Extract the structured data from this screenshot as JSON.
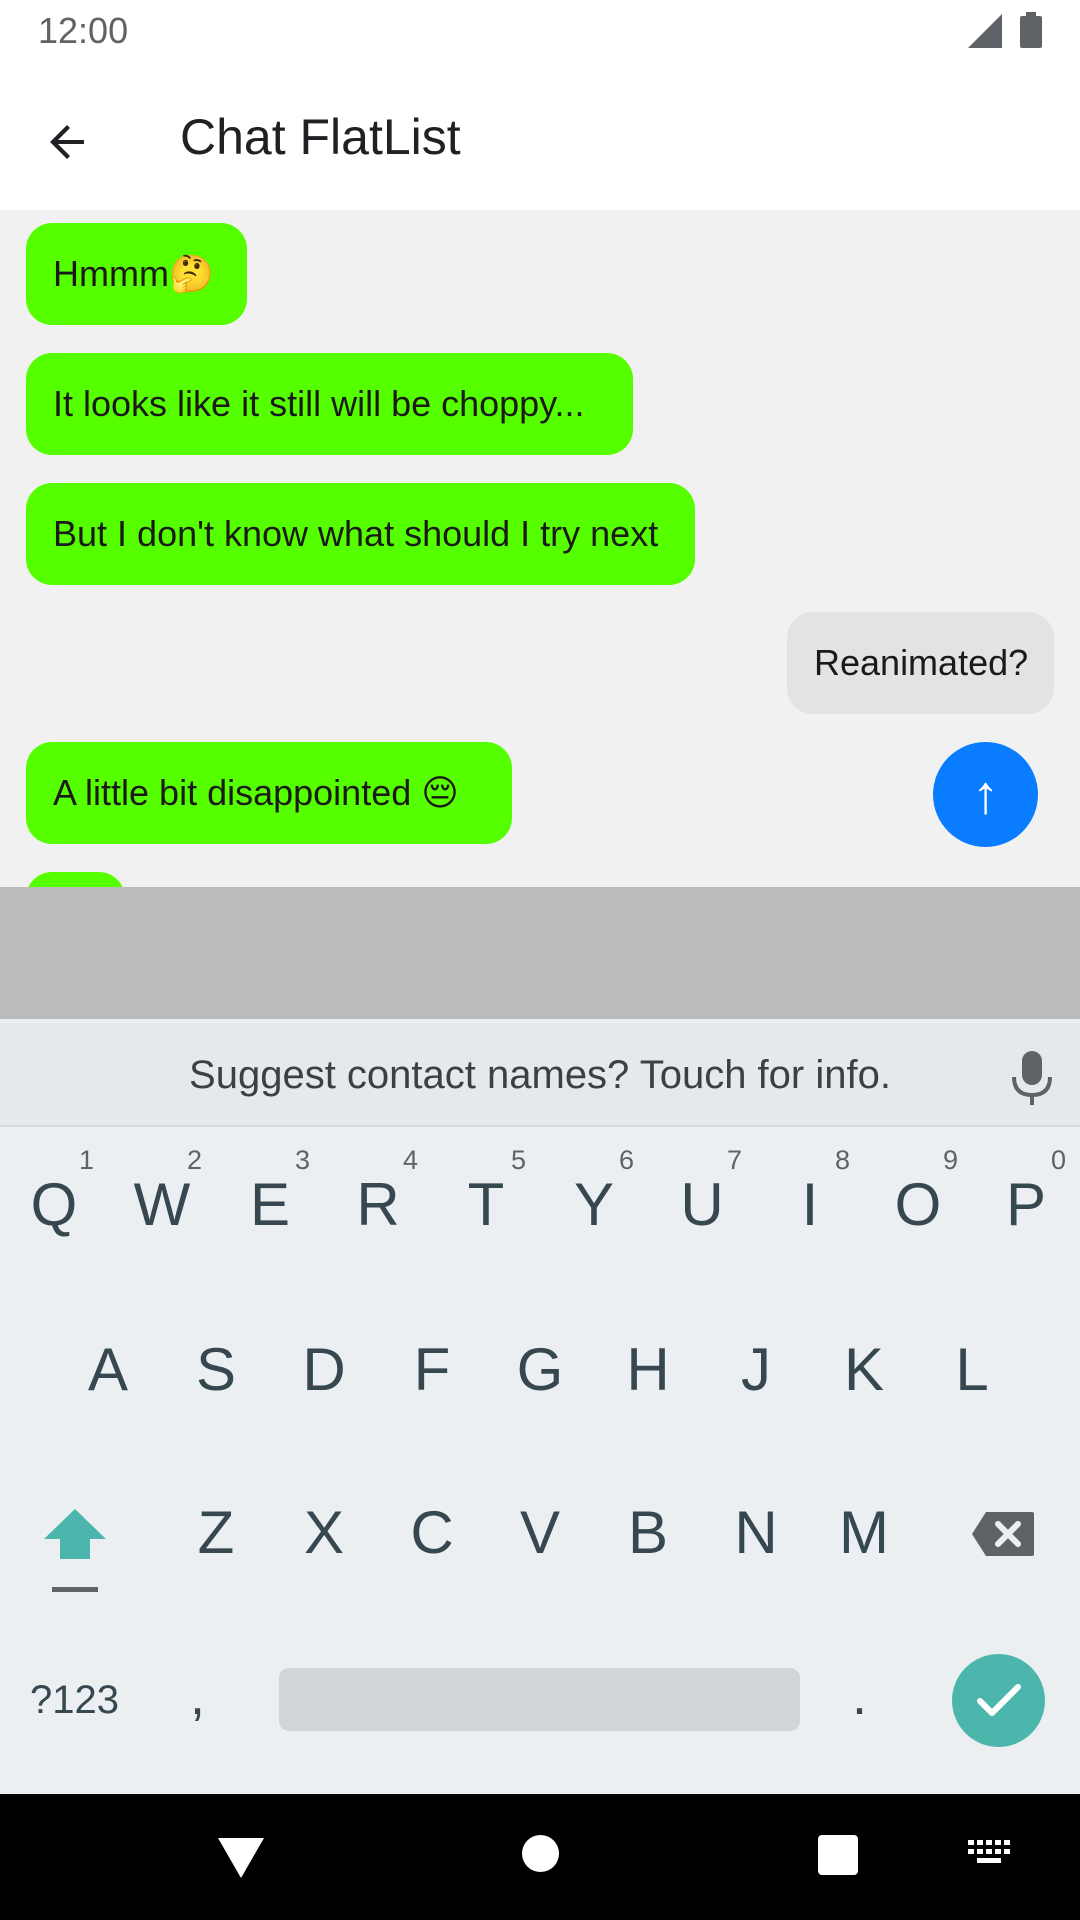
{
  "status_bar": {
    "time": "12:00"
  },
  "app_bar": {
    "title": "Chat FlatList"
  },
  "messages": [
    {
      "text": "Hmmm🤔",
      "from": "other"
    },
    {
      "text": "It looks like it still will be choppy...",
      "from": "other"
    },
    {
      "text": "But I don't know what should I try next",
      "from": "other"
    },
    {
      "text": "Reanimated?",
      "from": "me"
    },
    {
      "text": "A little bit disappointed 😔",
      "from": "other"
    }
  ],
  "scroll_button": {
    "icon": "↑"
  },
  "keyboard": {
    "suggestion": "Suggest contact names? Touch for info.",
    "row1": [
      "Q",
      "W",
      "E",
      "R",
      "T",
      "Y",
      "U",
      "I",
      "O",
      "P"
    ],
    "row1_hints": [
      "1",
      "2",
      "3",
      "4",
      "5",
      "6",
      "7",
      "8",
      "9",
      "0"
    ],
    "row2": [
      "A",
      "S",
      "D",
      "F",
      "G",
      "H",
      "J",
      "K",
      "L"
    ],
    "row3": [
      "Z",
      "X",
      "C",
      "V",
      "B",
      "N",
      "M"
    ],
    "symbols_label": "?123",
    "comma": ",",
    "period": "."
  },
  "colors": {
    "incoming_bubble": "#55ff00",
    "outgoing_bubble": "#e3e3e3",
    "fab": "#0a7cff",
    "enter_key": "#4db6ac",
    "shift_key": "#4db6ac"
  }
}
